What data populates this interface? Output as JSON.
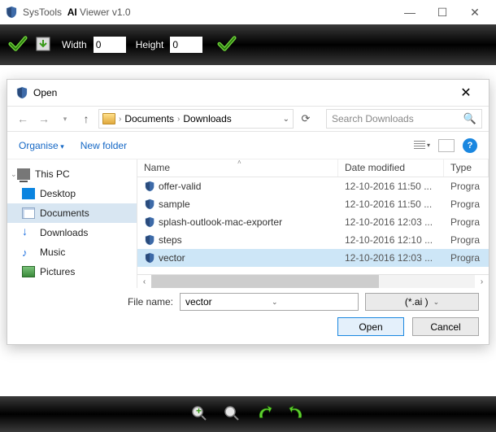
{
  "app": {
    "vendor": "SysTools",
    "name_bold": "AI",
    "name_rest": " Viewer v1.0"
  },
  "toolbar": {
    "width_label": "Width",
    "width_value": "0",
    "height_label": "Height",
    "height_value": "0"
  },
  "dialog": {
    "title": "Open",
    "breadcrumb": {
      "a": "Documents",
      "b": "Downloads"
    },
    "refresh_icon": "refresh",
    "search_placeholder": "Search Downloads",
    "organise": "Organise",
    "new_folder": "New folder",
    "help": "?",
    "tree": [
      {
        "label": "This PC",
        "icon": "pc",
        "root": true
      },
      {
        "label": "Desktop",
        "icon": "desktop"
      },
      {
        "label": "Documents",
        "icon": "doc",
        "selected": true
      },
      {
        "label": "Downloads",
        "icon": "dl"
      },
      {
        "label": "Music",
        "icon": "music"
      },
      {
        "label": "Pictures",
        "icon": "pic"
      }
    ],
    "columns": {
      "name": "Name",
      "date": "Date modified",
      "type": "Type"
    },
    "files": [
      {
        "name": "offer-valid",
        "date": "12-10-2016 11:50 ...",
        "type": "Progra"
      },
      {
        "name": "sample",
        "date": "12-10-2016 11:50 ...",
        "type": "Progra"
      },
      {
        "name": "splash-outlook-mac-exporter",
        "date": "12-10-2016 12:03 ...",
        "type": "Progra"
      },
      {
        "name": "steps",
        "date": "12-10-2016 12:10 ...",
        "type": "Progra"
      },
      {
        "name": "vector",
        "date": "12-10-2016 12:03 ...",
        "type": "Progra",
        "selected": true
      }
    ],
    "filename_label": "File name:",
    "filename_value": "vector",
    "filetype": "(*.ai  )",
    "open_btn": "Open",
    "cancel_btn": "Cancel"
  }
}
